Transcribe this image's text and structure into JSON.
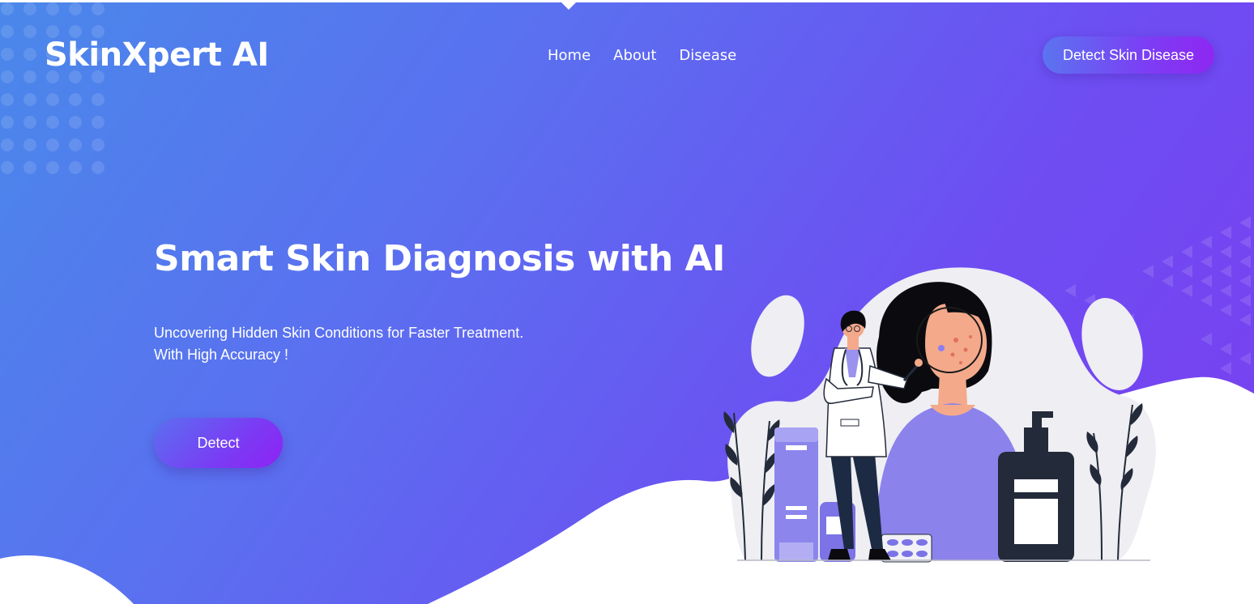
{
  "header": {
    "logo": "SkinXpert AI",
    "nav": [
      {
        "label": "Home"
      },
      {
        "label": "About"
      },
      {
        "label": "Disease"
      }
    ],
    "cta_label": "Detect Skin Disease"
  },
  "hero": {
    "title": "Smart Skin Diagnosis with AI",
    "subtitle_lines": [
      "Uncovering Hidden Skin Conditions for Faster Treatment.",
      "With High Accuracy !"
    ],
    "detect_label": "Detect",
    "illustration_icon": "doctor-examining-patient-skin-illustration"
  },
  "colors": {
    "gradient_start": "#4a88ea",
    "gradient_end": "#7a3ff0",
    "button_accent": "#8e27f2",
    "text": "#ffffff"
  }
}
